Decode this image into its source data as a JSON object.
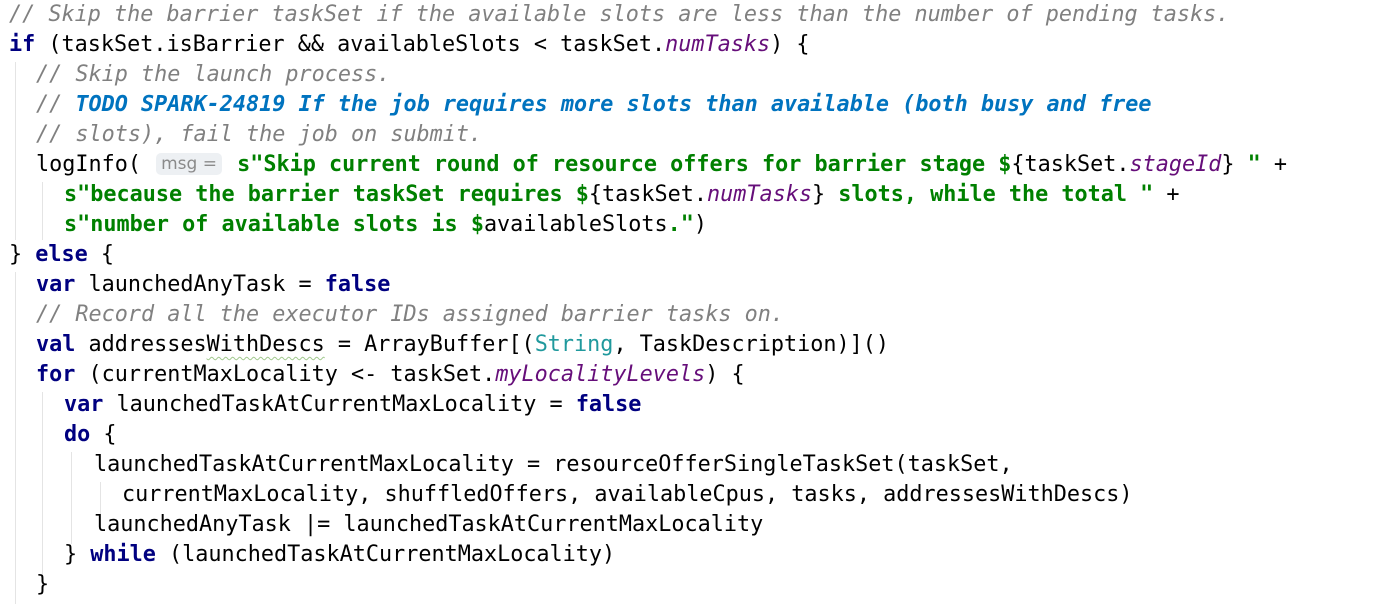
{
  "editor": {
    "parameter_hint": "msg =",
    "lines": [
      {
        "indent": 0,
        "tokens": [
          {
            "t": "cmt",
            "v": "// Skip the barrier taskSet if the available slots are less than the number of pending tasks."
          }
        ]
      },
      {
        "indent": 0,
        "tokens": [
          {
            "t": "kw",
            "v": "if"
          },
          {
            "t": "pl",
            "v": " (taskSet.isBarrier && availableSlots < taskSet."
          },
          {
            "t": "fld",
            "v": "numTasks"
          },
          {
            "t": "pl",
            "v": ") {"
          }
        ]
      },
      {
        "indent": 1,
        "tokens": [
          {
            "t": "cmt",
            "v": "// Skip the launch process."
          }
        ]
      },
      {
        "indent": 1,
        "tokens": [
          {
            "t": "cmt",
            "v": "// "
          },
          {
            "t": "todo",
            "v": "TODO SPARK-24819 If the job requires more slots than available (both busy and free"
          }
        ]
      },
      {
        "indent": 1,
        "tokens": [
          {
            "t": "cmt",
            "v": "// slots), fail the job on submit."
          }
        ]
      },
      {
        "indent": 1,
        "tokens": [
          {
            "t": "pl",
            "v": "logInfo( "
          },
          {
            "t": "hint",
            "v": "msg ="
          },
          {
            "t": "str",
            "v": " s\"Skip current round of resource offers for barrier stage "
          },
          {
            "t": "interp",
            "v": "$"
          },
          {
            "t": "pl",
            "v": "{taskSet."
          },
          {
            "t": "fld",
            "v": "stageId"
          },
          {
            "t": "pl",
            "v": "}"
          },
          {
            "t": "str",
            "v": " \""
          },
          {
            "t": "pl",
            "v": " +"
          }
        ]
      },
      {
        "indent": 2,
        "tokens": [
          {
            "t": "str",
            "v": "s\"because the barrier taskSet requires "
          },
          {
            "t": "interp",
            "v": "$"
          },
          {
            "t": "pl",
            "v": "{taskSet."
          },
          {
            "t": "fld",
            "v": "numTasks"
          },
          {
            "t": "pl",
            "v": "}"
          },
          {
            "t": "str",
            "v": " slots, while the total \""
          },
          {
            "t": "pl",
            "v": " +"
          }
        ]
      },
      {
        "indent": 2,
        "tokens": [
          {
            "t": "str",
            "v": "s\"number of available slots is "
          },
          {
            "t": "interp",
            "v": "$"
          },
          {
            "t": "pl",
            "v": "availableSlots"
          },
          {
            "t": "str",
            "v": ".\""
          },
          {
            "t": "pl",
            "v": ")"
          }
        ]
      },
      {
        "indent": 0,
        "tokens": [
          {
            "t": "pl",
            "v": "} "
          },
          {
            "t": "kw",
            "v": "else"
          },
          {
            "t": "pl",
            "v": " {"
          }
        ]
      },
      {
        "indent": 1,
        "tokens": [
          {
            "t": "kw",
            "v": "var"
          },
          {
            "t": "pl",
            "v": " launchedAnyTask = "
          },
          {
            "t": "kw",
            "v": "false"
          }
        ]
      },
      {
        "indent": 1,
        "tokens": [
          {
            "t": "cmt",
            "v": "// Record all the executor IDs assigned barrier tasks on."
          }
        ]
      },
      {
        "indent": 1,
        "tokens": [
          {
            "t": "kw",
            "v": "val"
          },
          {
            "t": "pl",
            "v": " addresses"
          },
          {
            "t": "squiggle",
            "v": "WithDescs"
          },
          {
            "t": "pl",
            "v": " = ArrayBuffer[("
          },
          {
            "t": "typ",
            "v": "String"
          },
          {
            "t": "pl",
            "v": ", TaskDescription)]()"
          }
        ]
      },
      {
        "indent": 1,
        "tokens": [
          {
            "t": "kw",
            "v": "for"
          },
          {
            "t": "pl",
            "v": " (currentMaxLocality <- taskSet."
          },
          {
            "t": "fld",
            "v": "myLocalityLevels"
          },
          {
            "t": "pl",
            "v": ") {"
          }
        ]
      },
      {
        "indent": 2,
        "tokens": [
          {
            "t": "kw",
            "v": "var"
          },
          {
            "t": "pl",
            "v": " launchedTaskAtCurrentMaxLocality = "
          },
          {
            "t": "kw",
            "v": "false"
          }
        ]
      },
      {
        "indent": 2,
        "tokens": [
          {
            "t": "kw",
            "v": "do"
          },
          {
            "t": "pl",
            "v": " {"
          }
        ]
      },
      {
        "indent": 3,
        "tokens": [
          {
            "t": "pl",
            "v": "launchedTaskAtCurrentMaxLocality = resourceOfferSingleTaskSet(taskSet,"
          }
        ]
      },
      {
        "indent": 4,
        "tokens": [
          {
            "t": "pl",
            "v": "currentMaxLocality, shuffledOffers, availableCpus, tasks, addressesWithDescs)"
          }
        ]
      },
      {
        "indent": 3,
        "tokens": [
          {
            "t": "pl",
            "v": "launchedAnyTask |= launchedTaskAtCurrentMaxLocality"
          }
        ]
      },
      {
        "indent": 2,
        "tokens": [
          {
            "t": "pl",
            "v": "} "
          },
          {
            "t": "kw",
            "v": "while"
          },
          {
            "t": "pl",
            "v": " (launchedTaskAtCurrentMaxLocality)"
          }
        ]
      },
      {
        "indent": 1,
        "tokens": [
          {
            "t": "pl",
            "v": "}"
          }
        ]
      }
    ]
  }
}
